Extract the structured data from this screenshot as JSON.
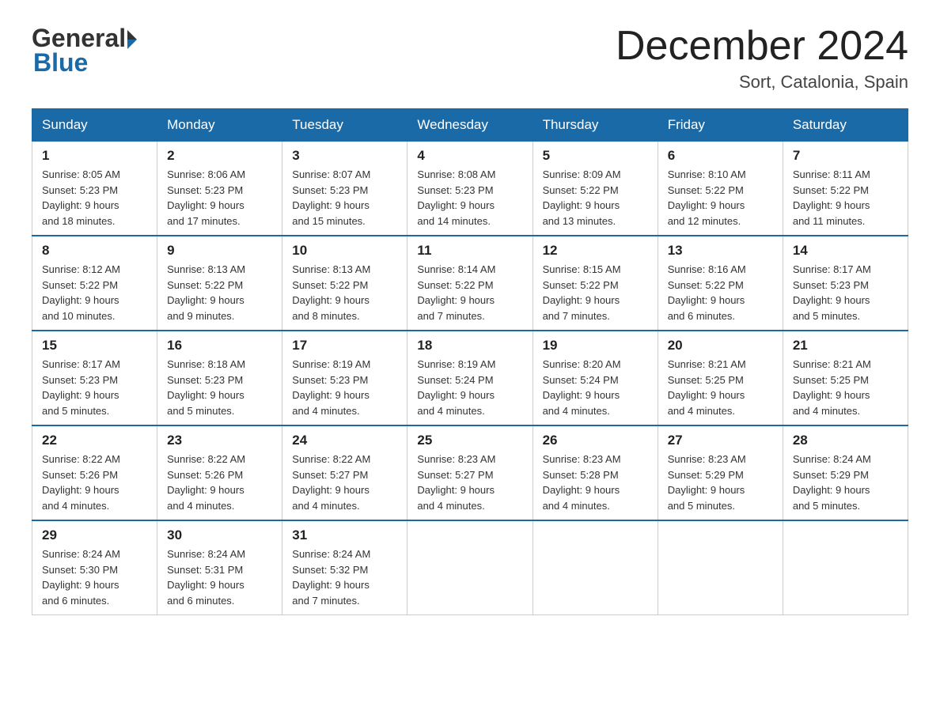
{
  "header": {
    "title": "December 2024",
    "location": "Sort, Catalonia, Spain",
    "logo_general": "General",
    "logo_blue": "Blue"
  },
  "days_of_week": [
    "Sunday",
    "Monday",
    "Tuesday",
    "Wednesday",
    "Thursday",
    "Friday",
    "Saturday"
  ],
  "weeks": [
    [
      {
        "num": "1",
        "sunrise": "8:05 AM",
        "sunset": "5:23 PM",
        "daylight": "9 hours and 18 minutes."
      },
      {
        "num": "2",
        "sunrise": "8:06 AM",
        "sunset": "5:23 PM",
        "daylight": "9 hours and 17 minutes."
      },
      {
        "num": "3",
        "sunrise": "8:07 AM",
        "sunset": "5:23 PM",
        "daylight": "9 hours and 15 minutes."
      },
      {
        "num": "4",
        "sunrise": "8:08 AM",
        "sunset": "5:23 PM",
        "daylight": "9 hours and 14 minutes."
      },
      {
        "num": "5",
        "sunrise": "8:09 AM",
        "sunset": "5:22 PM",
        "daylight": "9 hours and 13 minutes."
      },
      {
        "num": "6",
        "sunrise": "8:10 AM",
        "sunset": "5:22 PM",
        "daylight": "9 hours and 12 minutes."
      },
      {
        "num": "7",
        "sunrise": "8:11 AM",
        "sunset": "5:22 PM",
        "daylight": "9 hours and 11 minutes."
      }
    ],
    [
      {
        "num": "8",
        "sunrise": "8:12 AM",
        "sunset": "5:22 PM",
        "daylight": "9 hours and 10 minutes."
      },
      {
        "num": "9",
        "sunrise": "8:13 AM",
        "sunset": "5:22 PM",
        "daylight": "9 hours and 9 minutes."
      },
      {
        "num": "10",
        "sunrise": "8:13 AM",
        "sunset": "5:22 PM",
        "daylight": "9 hours and 8 minutes."
      },
      {
        "num": "11",
        "sunrise": "8:14 AM",
        "sunset": "5:22 PM",
        "daylight": "9 hours and 7 minutes."
      },
      {
        "num": "12",
        "sunrise": "8:15 AM",
        "sunset": "5:22 PM",
        "daylight": "9 hours and 7 minutes."
      },
      {
        "num": "13",
        "sunrise": "8:16 AM",
        "sunset": "5:22 PM",
        "daylight": "9 hours and 6 minutes."
      },
      {
        "num": "14",
        "sunrise": "8:17 AM",
        "sunset": "5:23 PM",
        "daylight": "9 hours and 5 minutes."
      }
    ],
    [
      {
        "num": "15",
        "sunrise": "8:17 AM",
        "sunset": "5:23 PM",
        "daylight": "9 hours and 5 minutes."
      },
      {
        "num": "16",
        "sunrise": "8:18 AM",
        "sunset": "5:23 PM",
        "daylight": "9 hours and 5 minutes."
      },
      {
        "num": "17",
        "sunrise": "8:19 AM",
        "sunset": "5:23 PM",
        "daylight": "9 hours and 4 minutes."
      },
      {
        "num": "18",
        "sunrise": "8:19 AM",
        "sunset": "5:24 PM",
        "daylight": "9 hours and 4 minutes."
      },
      {
        "num": "19",
        "sunrise": "8:20 AM",
        "sunset": "5:24 PM",
        "daylight": "9 hours and 4 minutes."
      },
      {
        "num": "20",
        "sunrise": "8:21 AM",
        "sunset": "5:25 PM",
        "daylight": "9 hours and 4 minutes."
      },
      {
        "num": "21",
        "sunrise": "8:21 AM",
        "sunset": "5:25 PM",
        "daylight": "9 hours and 4 minutes."
      }
    ],
    [
      {
        "num": "22",
        "sunrise": "8:22 AM",
        "sunset": "5:26 PM",
        "daylight": "9 hours and 4 minutes."
      },
      {
        "num": "23",
        "sunrise": "8:22 AM",
        "sunset": "5:26 PM",
        "daylight": "9 hours and 4 minutes."
      },
      {
        "num": "24",
        "sunrise": "8:22 AM",
        "sunset": "5:27 PM",
        "daylight": "9 hours and 4 minutes."
      },
      {
        "num": "25",
        "sunrise": "8:23 AM",
        "sunset": "5:27 PM",
        "daylight": "9 hours and 4 minutes."
      },
      {
        "num": "26",
        "sunrise": "8:23 AM",
        "sunset": "5:28 PM",
        "daylight": "9 hours and 4 minutes."
      },
      {
        "num": "27",
        "sunrise": "8:23 AM",
        "sunset": "5:29 PM",
        "daylight": "9 hours and 5 minutes."
      },
      {
        "num": "28",
        "sunrise": "8:24 AM",
        "sunset": "5:29 PM",
        "daylight": "9 hours and 5 minutes."
      }
    ],
    [
      {
        "num": "29",
        "sunrise": "8:24 AM",
        "sunset": "5:30 PM",
        "daylight": "9 hours and 6 minutes."
      },
      {
        "num": "30",
        "sunrise": "8:24 AM",
        "sunset": "5:31 PM",
        "daylight": "9 hours and 6 minutes."
      },
      {
        "num": "31",
        "sunrise": "8:24 AM",
        "sunset": "5:32 PM",
        "daylight": "9 hours and 7 minutes."
      },
      null,
      null,
      null,
      null
    ]
  ],
  "labels": {
    "sunrise": "Sunrise:",
    "sunset": "Sunset:",
    "daylight": "Daylight:"
  }
}
